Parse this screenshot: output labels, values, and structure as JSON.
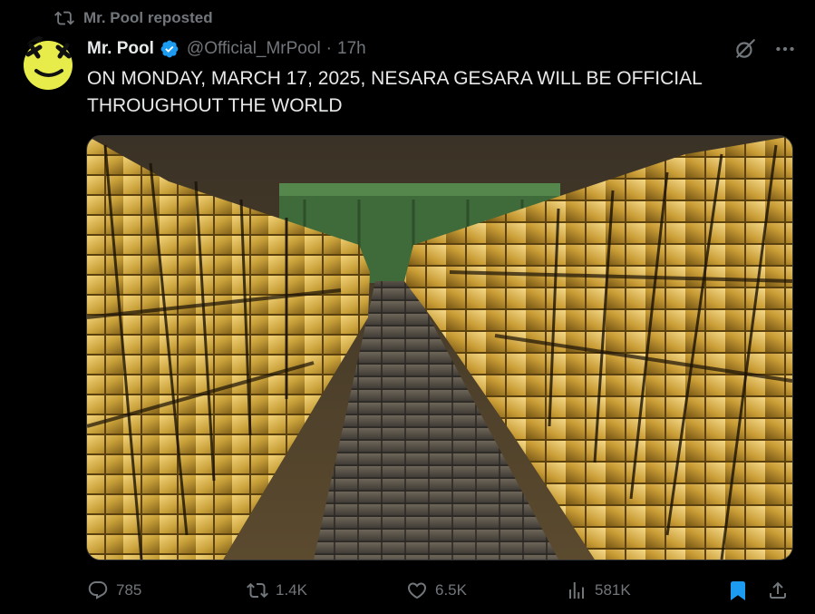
{
  "repost": {
    "label": "Mr. Pool reposted"
  },
  "author": {
    "name": "Mr. Pool",
    "handle": "@Official_MrPool",
    "separator": "·",
    "time": "17h"
  },
  "post": {
    "text": "ON MONDAY, MARCH 17, 2025, NESARA GESARA WILL BE OFFICIAL THROUGHOUT THE WORLD"
  },
  "actions": {
    "replies": "785",
    "reposts": "1.4K",
    "likes": "6.5K",
    "views": "581K"
  },
  "icons": {
    "repost": "repost-icon",
    "verified": "verified-badge-icon",
    "grok": "grok-icon",
    "more": "more-icon",
    "reply": "reply-icon",
    "like": "heart-icon",
    "views": "views-icon",
    "bookmark": "bookmark-icon",
    "share": "share-icon"
  },
  "colors": {
    "background": "#000000",
    "text": "#e7e9ea",
    "muted": "#71767b",
    "verified": "#1d9bf0",
    "bookmark_active": "#1d9bf0",
    "gold": "#c9a13a"
  }
}
